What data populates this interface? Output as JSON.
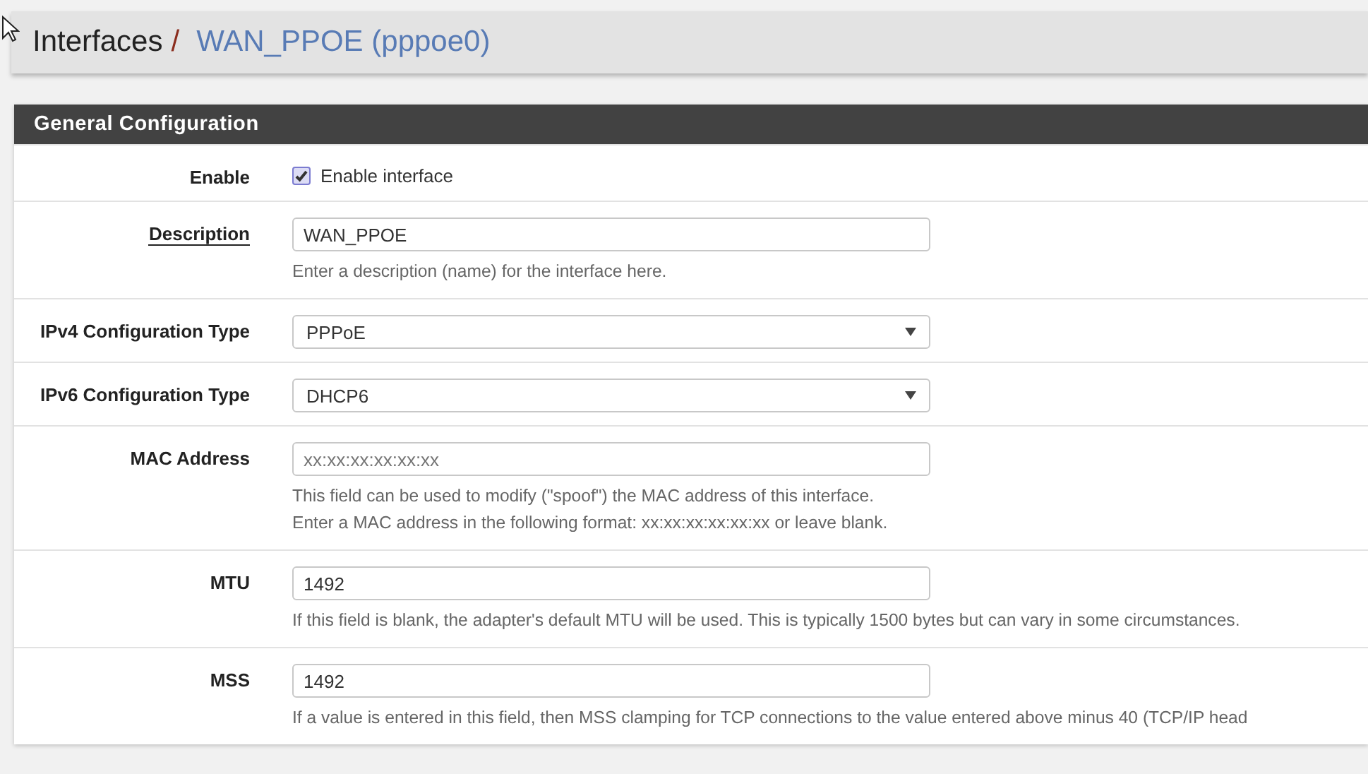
{
  "breadcrumb": {
    "parent": "Interfaces",
    "separator": "/",
    "current": "WAN_PPOE (pppoe0)"
  },
  "panel": {
    "title": "General Configuration",
    "rows": [
      {
        "kind": "checkbox",
        "label": "Enable",
        "label_link": false,
        "checked": true,
        "text": "Enable interface"
      },
      {
        "kind": "text",
        "label": "Description",
        "label_link": true,
        "value": "WAN_PPOE",
        "help": [
          "Enter a description (name) for the interface here."
        ]
      },
      {
        "kind": "select",
        "label": "IPv4 Configuration Type",
        "label_link": false,
        "value": "PPPoE"
      },
      {
        "kind": "select",
        "label": "IPv6 Configuration Type",
        "label_link": false,
        "value": "DHCP6"
      },
      {
        "kind": "text",
        "label": "MAC Address",
        "label_link": false,
        "placeholder": "xx:xx:xx:xx:xx:xx",
        "help": [
          "This field can be used to modify (\"spoof\") the MAC address of this interface.",
          "Enter a MAC address in the following format: xx:xx:xx:xx:xx:xx or leave blank."
        ]
      },
      {
        "kind": "text",
        "label": "MTU",
        "label_link": false,
        "value": "1492",
        "help": [
          "If this field is blank, the adapter's default MTU will be used. This is typically 1500 bytes but can vary in some circumstances."
        ]
      },
      {
        "kind": "text",
        "label": "MSS",
        "label_link": false,
        "value": "1492",
        "help": [
          "If a value is entered in this field, then MSS clamping for TCP connections to the value entered above minus 40 (TCP/IP head"
        ]
      }
    ]
  }
}
